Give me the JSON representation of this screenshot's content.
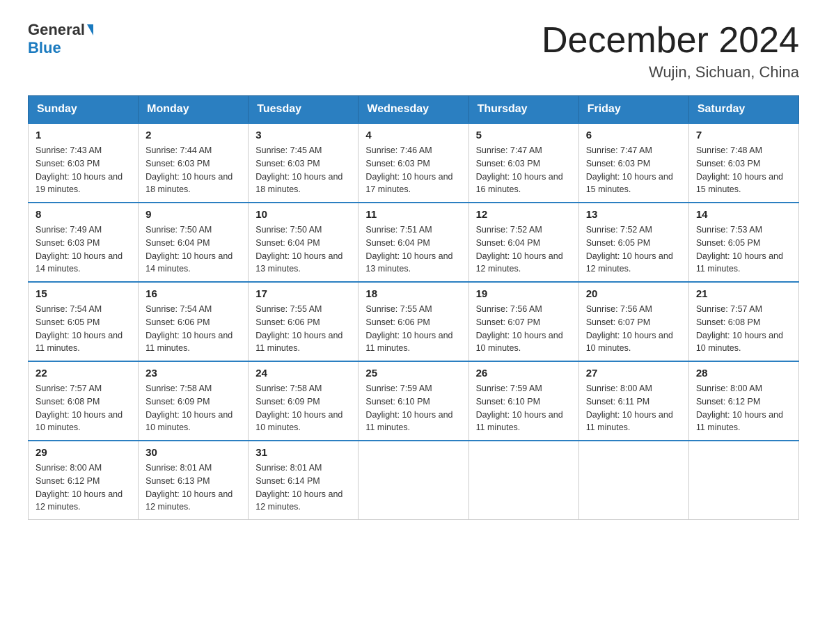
{
  "header": {
    "logo_general": "General",
    "logo_blue": "Blue",
    "month_title": "December 2024",
    "location": "Wujin, Sichuan, China"
  },
  "weekdays": [
    "Sunday",
    "Monday",
    "Tuesday",
    "Wednesday",
    "Thursday",
    "Friday",
    "Saturday"
  ],
  "weeks": [
    [
      {
        "day": "1",
        "sunrise": "7:43 AM",
        "sunset": "6:03 PM",
        "daylight": "10 hours and 19 minutes."
      },
      {
        "day": "2",
        "sunrise": "7:44 AM",
        "sunset": "6:03 PM",
        "daylight": "10 hours and 18 minutes."
      },
      {
        "day": "3",
        "sunrise": "7:45 AM",
        "sunset": "6:03 PM",
        "daylight": "10 hours and 18 minutes."
      },
      {
        "day": "4",
        "sunrise": "7:46 AM",
        "sunset": "6:03 PM",
        "daylight": "10 hours and 17 minutes."
      },
      {
        "day": "5",
        "sunrise": "7:47 AM",
        "sunset": "6:03 PM",
        "daylight": "10 hours and 16 minutes."
      },
      {
        "day": "6",
        "sunrise": "7:47 AM",
        "sunset": "6:03 PM",
        "daylight": "10 hours and 15 minutes."
      },
      {
        "day": "7",
        "sunrise": "7:48 AM",
        "sunset": "6:03 PM",
        "daylight": "10 hours and 15 minutes."
      }
    ],
    [
      {
        "day": "8",
        "sunrise": "7:49 AM",
        "sunset": "6:03 PM",
        "daylight": "10 hours and 14 minutes."
      },
      {
        "day": "9",
        "sunrise": "7:50 AM",
        "sunset": "6:04 PM",
        "daylight": "10 hours and 14 minutes."
      },
      {
        "day": "10",
        "sunrise": "7:50 AM",
        "sunset": "6:04 PM",
        "daylight": "10 hours and 13 minutes."
      },
      {
        "day": "11",
        "sunrise": "7:51 AM",
        "sunset": "6:04 PM",
        "daylight": "10 hours and 13 minutes."
      },
      {
        "day": "12",
        "sunrise": "7:52 AM",
        "sunset": "6:04 PM",
        "daylight": "10 hours and 12 minutes."
      },
      {
        "day": "13",
        "sunrise": "7:52 AM",
        "sunset": "6:05 PM",
        "daylight": "10 hours and 12 minutes."
      },
      {
        "day": "14",
        "sunrise": "7:53 AM",
        "sunset": "6:05 PM",
        "daylight": "10 hours and 11 minutes."
      }
    ],
    [
      {
        "day": "15",
        "sunrise": "7:54 AM",
        "sunset": "6:05 PM",
        "daylight": "10 hours and 11 minutes."
      },
      {
        "day": "16",
        "sunrise": "7:54 AM",
        "sunset": "6:06 PM",
        "daylight": "10 hours and 11 minutes."
      },
      {
        "day": "17",
        "sunrise": "7:55 AM",
        "sunset": "6:06 PM",
        "daylight": "10 hours and 11 minutes."
      },
      {
        "day": "18",
        "sunrise": "7:55 AM",
        "sunset": "6:06 PM",
        "daylight": "10 hours and 11 minutes."
      },
      {
        "day": "19",
        "sunrise": "7:56 AM",
        "sunset": "6:07 PM",
        "daylight": "10 hours and 10 minutes."
      },
      {
        "day": "20",
        "sunrise": "7:56 AM",
        "sunset": "6:07 PM",
        "daylight": "10 hours and 10 minutes."
      },
      {
        "day": "21",
        "sunrise": "7:57 AM",
        "sunset": "6:08 PM",
        "daylight": "10 hours and 10 minutes."
      }
    ],
    [
      {
        "day": "22",
        "sunrise": "7:57 AM",
        "sunset": "6:08 PM",
        "daylight": "10 hours and 10 minutes."
      },
      {
        "day": "23",
        "sunrise": "7:58 AM",
        "sunset": "6:09 PM",
        "daylight": "10 hours and 10 minutes."
      },
      {
        "day": "24",
        "sunrise": "7:58 AM",
        "sunset": "6:09 PM",
        "daylight": "10 hours and 10 minutes."
      },
      {
        "day": "25",
        "sunrise": "7:59 AM",
        "sunset": "6:10 PM",
        "daylight": "10 hours and 11 minutes."
      },
      {
        "day": "26",
        "sunrise": "7:59 AM",
        "sunset": "6:10 PM",
        "daylight": "10 hours and 11 minutes."
      },
      {
        "day": "27",
        "sunrise": "8:00 AM",
        "sunset": "6:11 PM",
        "daylight": "10 hours and 11 minutes."
      },
      {
        "day": "28",
        "sunrise": "8:00 AM",
        "sunset": "6:12 PM",
        "daylight": "10 hours and 11 minutes."
      }
    ],
    [
      {
        "day": "29",
        "sunrise": "8:00 AM",
        "sunset": "6:12 PM",
        "daylight": "10 hours and 12 minutes."
      },
      {
        "day": "30",
        "sunrise": "8:01 AM",
        "sunset": "6:13 PM",
        "daylight": "10 hours and 12 minutes."
      },
      {
        "day": "31",
        "sunrise": "8:01 AM",
        "sunset": "6:14 PM",
        "daylight": "10 hours and 12 minutes."
      },
      null,
      null,
      null,
      null
    ]
  ]
}
